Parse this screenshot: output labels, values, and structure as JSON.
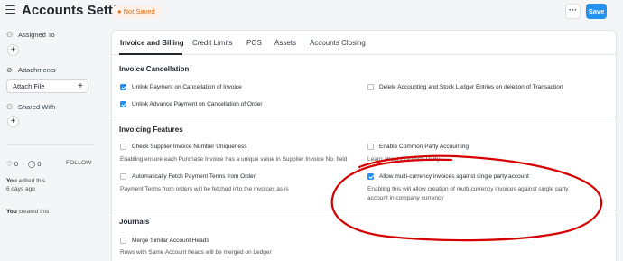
{
  "header": {
    "title": "Accounts Settings",
    "status_badge": "Not Saved",
    "more_label": "···",
    "save_label": "Save"
  },
  "sidebar": {
    "assigned_to": "Assigned To",
    "attachments": "Attachments",
    "attach_file": "Attach File",
    "shared_with": "Shared With",
    "likes": "0",
    "comments": "0",
    "follow": "FOLLOW",
    "activity": [
      {
        "actor": "You",
        "text": " edited this",
        "when": "6 days ago"
      },
      {
        "actor": "You",
        "text": " created this",
        "when": ""
      }
    ]
  },
  "tabs": [
    "Invoice and Billing",
    "Credit Limits",
    "POS",
    "Assets",
    "Accounts Closing"
  ],
  "sections": {
    "invoice_cancellation": {
      "title": "Invoice Cancellation",
      "unlink_payment": "Unlink Payment on Cancellation of Invoice",
      "unlink_advance": "Unlink Advance Payment on Cancellation of Order",
      "delete_entries": "Delete Accounting and Stock Ledger Entries on deletion of Transaction"
    },
    "invoicing_features": {
      "title": "Invoicing Features",
      "supplier_uniqueness": "Check Supplier Invoice Number Uniqueness",
      "supplier_uniqueness_desc": "Enabling ensure each Purchase Invoice has a unique value in Supplier Invoice No. field",
      "common_party": "Enable Common Party Accounting",
      "common_party_desc": "Learn about Common Party",
      "fetch_terms": "Automatically Fetch Payment Terms from Order",
      "fetch_terms_desc": "Payment Terms from orders will be fetched into the invoices as is",
      "multi_currency": "Allow multi-currency invoices against single party account",
      "multi_currency_desc_1": "Enabling this will allow creation of multi-currency invoices against single party",
      "multi_currency_desc_2": "account in company currency"
    },
    "journals": {
      "title": "Journals",
      "merge_heads": "Merge Similar Account Heads",
      "merge_heads_desc": "Rows with Same Account heads will be merged on Ledger"
    }
  },
  "colors": {
    "accent": "#2490ef",
    "badge_text": "#e86c13",
    "annotation": "#d40000"
  }
}
